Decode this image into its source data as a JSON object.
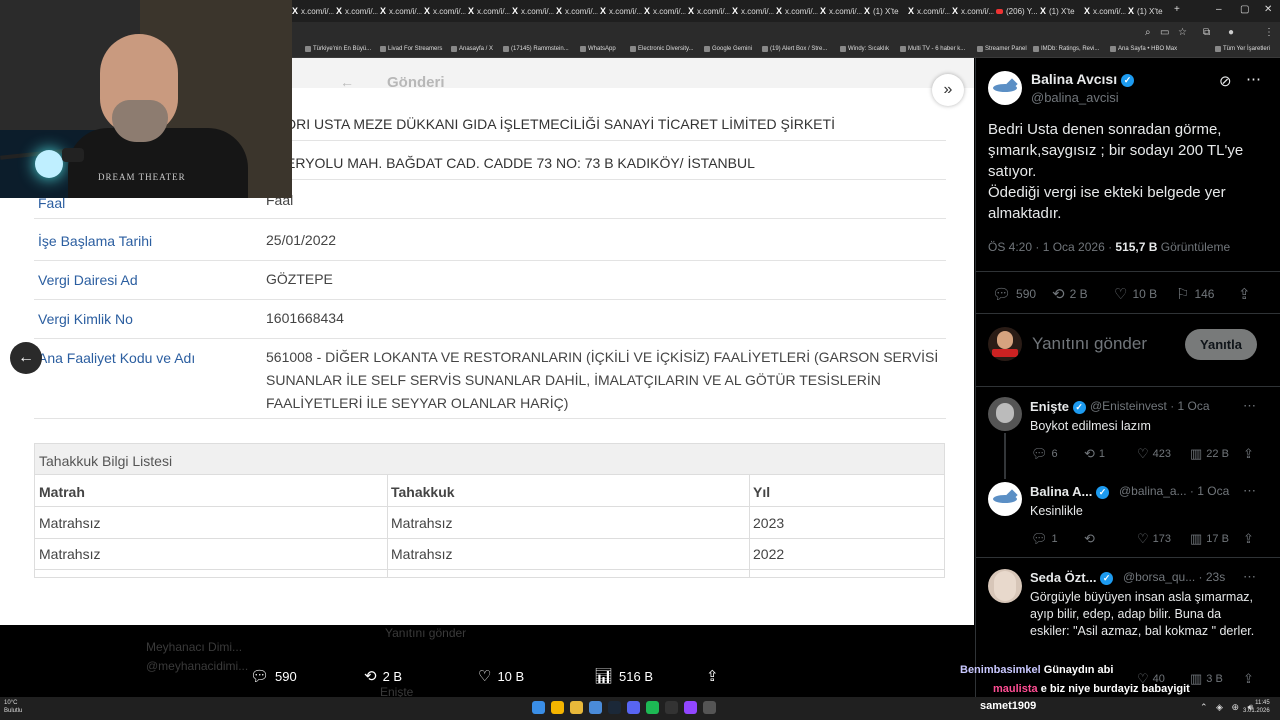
{
  "browser": {
    "tabs": [
      "x.com/i/...",
      "x.com/i/...",
      "x.com/i/...",
      "x.com/i/...",
      "x.com/i/...",
      "x.com/i/...",
      "x.com/i/...",
      "x.com/i/...",
      "x.com/i/...",
      "x.com/i/...",
      "x.com/i/...",
      "x.com/i/...",
      "x.com/i/...",
      "(1) X'te",
      "x.com/i/...",
      "x.com/i/...",
      "(206) Y...",
      "(1) X'te",
      "x.com/i/...",
      "(1) X'te"
    ],
    "bookmarks": [
      "Türkiye'nin En Büyü...",
      "Livad For Streamers",
      "Anasayfa / X",
      "(17145) Rammstein...",
      "WhatsApp",
      "Electronic Diversity...",
      "Google Gemini",
      "(19) Alert Box / Stre...",
      "Windy: Sıcaklık",
      "Multi TV - 6 haber k...",
      "Streamer Panel",
      "IMDb: Ratings, Revi...",
      "Ana Sayfa • HBO Max",
      "Tüm Yer İşaretleri"
    ]
  },
  "document": {
    "header_title": "Gönderi",
    "company_name": "DRI USTA MEZE DÜKKANI GIDA İŞLETMECİLİĞİ SANAYİ TİCARET LİMİTED ŞİRKETİ",
    "address": "ERYOLU MAH. BAĞDAT CAD. CADDE 73 NO: 73 B KADIKÖY/ İSTANBUL",
    "rows": [
      {
        "label": "Faal",
        "value": "Faal"
      },
      {
        "label": "İşe Başlama Tarihi",
        "value": "25/01/2022"
      },
      {
        "label": "Vergi Dairesi Ad",
        "value": "GÖZTEPE"
      },
      {
        "label": "Vergi Kimlik No",
        "value": "1601668434"
      },
      {
        "label": "Ana Faaliyet Kodu ve Adı",
        "value_lines": [
          "561008 - DİĞER LOKANTA VE RESTORANLARIN (İÇKİLİ VE İÇKİSİZ) FAALİYETLERİ (GARSON SERVİSİ",
          "SUNANLAR İLE SELF SERVİS SUNANLAR DAHİL, İMALATÇILARIN VE AL GÖTÜR TESİSLERİN",
          "FAALİYETLERİ İLE SEYYAR OLANLAR HARİÇ)"
        ]
      }
    ],
    "tahakkuk": {
      "title": "Tahakkuk Bilgi Listesi",
      "headers": [
        "Matrah",
        "Tahakkuk",
        "Yıl"
      ],
      "rows": [
        [
          "Matrahsız",
          "Matrahsız",
          "2023"
        ],
        [
          "Matrahsız",
          "Matrahsız",
          "2022"
        ]
      ]
    }
  },
  "webcam": {
    "shirt_text": "DREAM THEATER"
  },
  "bottom_bar": {
    "replies": "590",
    "reposts": "2 B",
    "likes": "10 B",
    "views": "516 B"
  },
  "ghost": {
    "name": "Meyhanacı Dimi...",
    "handle": "@meyhanacidimi...",
    "reply_placeholder": "Yanıtını gönder",
    "eniste": "Enişte"
  },
  "chat": [
    {
      "user": "Benimbasimkel",
      "message": "Günaydın abi"
    },
    {
      "user": "maulista",
      "message": "e biz niye burdayiz babayigit"
    }
  ],
  "post": {
    "name": "Balina Avcısı",
    "handle": "@balina_avcisi",
    "text_lines": [
      "Bedri Usta denen sonradan görme, şımarık,saygısız ; bir sodayı 200 TL'ye satıyor.",
      "Ödediği vergi ise ekteki belgede yer almaktadır."
    ],
    "time": "ÖS 4:20 · 1 Oca 2026 · ",
    "views": "515,7 B",
    "views_label": "Görüntüleme",
    "replies": "590",
    "reposts": "2 B",
    "likes": "10 B",
    "bookmarks": "146"
  },
  "reply_box": {
    "placeholder": "Yanıtını gönder",
    "button": "Yanıtla"
  },
  "replies": [
    {
      "name": "Enişte",
      "handle": "@Enisteinvest · 1 Oca",
      "text": "Boykot edilmesi lazım",
      "replies": "6",
      "reposts": "1",
      "likes": "423",
      "views": "22 B"
    },
    {
      "name": "Balina A...",
      "handle": "@balina_a... · 1 Oca",
      "text": "Kesinlikle",
      "replies": "1",
      "reposts": "",
      "likes": "173",
      "views": "17 B"
    },
    {
      "name": "Seda Özt...",
      "handle": "@borsa_qu... · 23s",
      "text": "Görgüyle büyüyen insan asla şımarmaz, ayıp bilir, edep, adap bilir. Buna da eskiler: \"Asil azmaz, bal kokmaz \" derler.",
      "replies": "",
      "reposts": "",
      "likes": "40",
      "views": "3 B"
    }
  ],
  "taskbar": {
    "temp": "10°C",
    "weather": "Bulutlu",
    "username": "samet1909",
    "time": "11:45",
    "date": "3.01.2026"
  },
  "colors": {
    "label_blue": "#2b5ea0",
    "x_verified": "#1d9bf0",
    "chat_pink": "#ff4d93"
  }
}
